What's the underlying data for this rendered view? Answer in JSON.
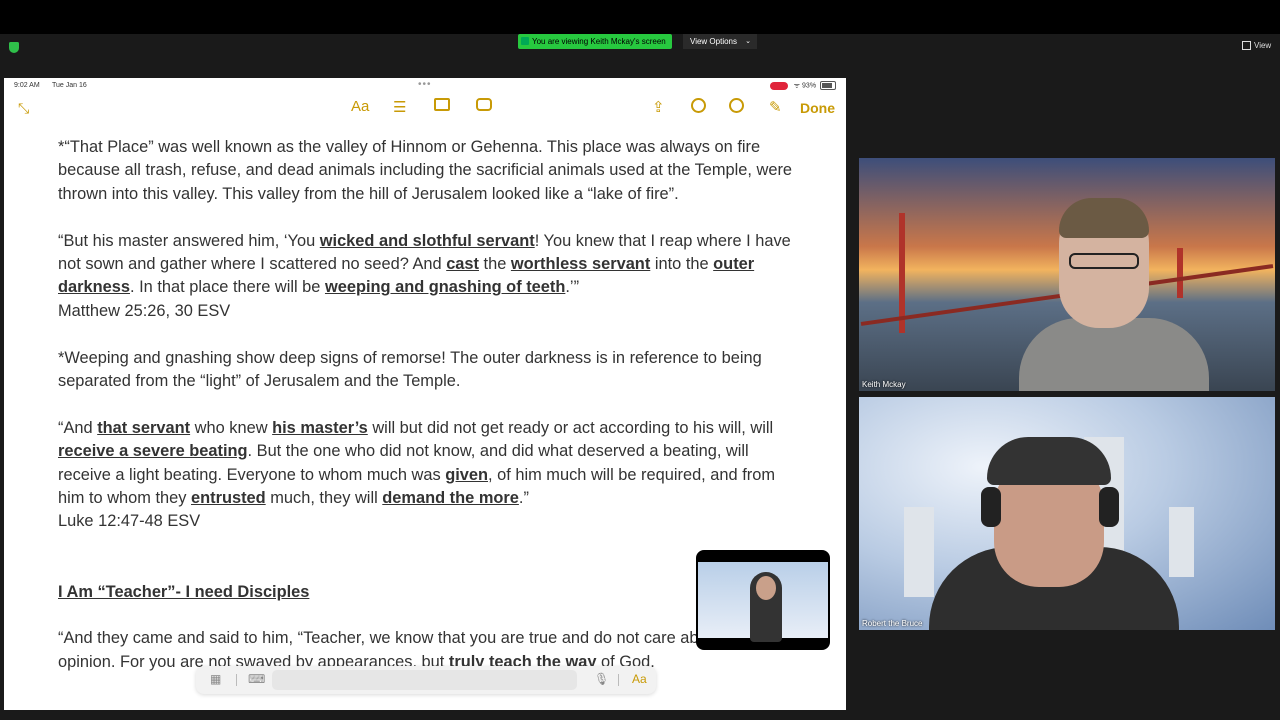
{
  "zoom": {
    "viewing_banner": "You are viewing Keith Mckay's screen",
    "view_options": "View Options",
    "view_button": "View"
  },
  "ipad": {
    "status": {
      "time": "9:02 AM",
      "date": "Tue Jan 16",
      "battery": "93%"
    },
    "toolbar": {
      "done": "Done",
      "format": "Aa"
    },
    "note": {
      "p1": "*“That Place” was well known as the valley of Hinnom or Gehenna. This place was always on fire because all trash, refuse, and dead animals including the sacrificial animals used at the Temple, were thrown into this valley. This valley from the hill of Jerusalem looked like a “lake of fire”.",
      "p2": {
        "a": "“But his master answered him, ‘You ",
        "b": "wicked and slothful servant",
        "c": "! You knew that I reap where I have not sown and gather where I scattered no seed? And ",
        "d": "cast",
        "e": " the ",
        "f": "worthless servant",
        "g": " into the ",
        "h": "outer darkness",
        "i": ". In that place there will be ",
        "j": "weeping and gnashing of teeth",
        "k": ".’”",
        "ref": "Matthew 25:26, 30 ESV"
      },
      "p3": "*Weeping and gnashing show deep signs of remorse! The outer darkness is in reference to being separated from the “light” of Jerusalem and the Temple.",
      "p4": {
        "a": "“And ",
        "b": "that servant",
        "c": " who knew ",
        "d": "his master’s",
        "e": " will but did not get ready or act according to his will, will ",
        "f": "receive a severe beating",
        "g": ". But the one who did not know, and did what deserved a beating, will receive a light beating. Everyone to whom much was ",
        "h": "given",
        "i": ", of him much will be required, and from him to whom they ",
        "j": "entrusted",
        "k": " much, they will ",
        "l": "demand the more",
        "m": ".”",
        "ref": "Luke 12:47-48 ESV"
      },
      "heading": "I Am “Teacher”- I need Disciples",
      "p5": {
        "a": "“And they came and said to him, “Teacher, we know that you are true and do not care about anyone’s opinion. For you are not swayed by appearances, but ",
        "b": "truly teach the way",
        "c": " of God."
      }
    },
    "keyboard_bar": {
      "format": "Aa"
    }
  },
  "participants": [
    {
      "name": "Keith Mckay"
    },
    {
      "name": "Robert the Bruce"
    }
  ]
}
